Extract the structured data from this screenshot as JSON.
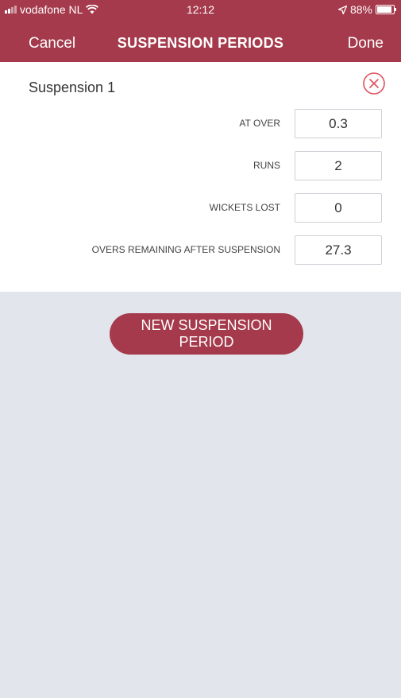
{
  "status_bar": {
    "carrier": "vodafone NL",
    "time": "12:12",
    "battery": "88%",
    "battery_level": 0.88
  },
  "nav": {
    "cancel_label": "Cancel",
    "title": "SUSPENSION PERIODS",
    "done_label": "Done"
  },
  "suspension": {
    "title": "Suspension 1",
    "fields": [
      {
        "label": "AT OVER",
        "value": "0.3"
      },
      {
        "label": "RUNS",
        "value": "2"
      },
      {
        "label": "WICKETS LOST",
        "value": "0"
      },
      {
        "label": "OVERS REMAINING AFTER SUSPENSION",
        "value": "27.3"
      }
    ]
  },
  "actions": {
    "new_period_label": "NEW SUSPENSION PERIOD"
  },
  "colors": {
    "brand": "#a53a4c",
    "background": "#e3e5ed",
    "close_icon": "#e0505c"
  }
}
